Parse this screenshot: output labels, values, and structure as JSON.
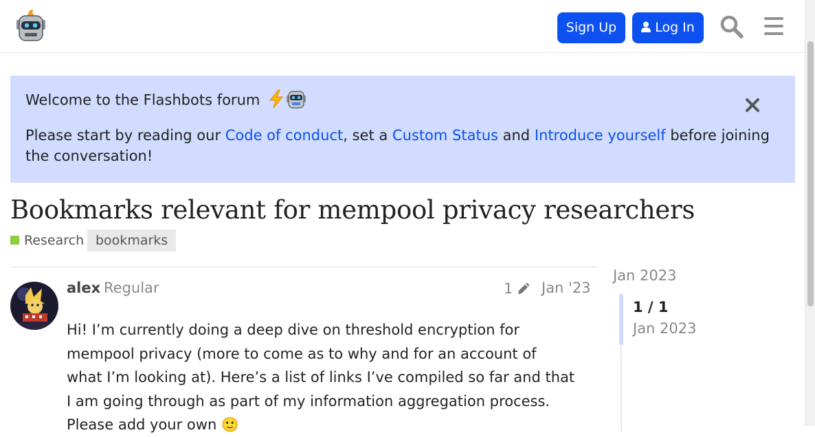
{
  "header": {
    "signup_label": "Sign Up",
    "login_label": "Log In",
    "accent_color": "#0c50f0",
    "logo_icon": "robot-logo",
    "search_icon": "search-icon",
    "menu_icon": "hamburger-menu-icon"
  },
  "banner": {
    "title": "Welcome to the Flashbots forum",
    "text_before": "Please start by reading our ",
    "link1": "Code of conduct",
    "text_mid1": ", set a ",
    "link2": "Custom Status",
    "text_mid2": " and ",
    "link3": "Introduce yourself",
    "text_after": " before joining the conversation!",
    "background": "#d1dcfe"
  },
  "topic": {
    "title": "Bookmarks relevant for mempool privacy researchers",
    "category": "Research",
    "category_color": "#92cc41",
    "tag": "bookmarks"
  },
  "post": {
    "username": "alex",
    "user_title": "Regular",
    "edit_count": "1",
    "date": "Jan '23",
    "body": "Hi! I’m currently doing a deep dive on threshold encryption for mempool privacy (more to come as to why and for an account of what I’m looking at). Here’s a list of links I’ve compiled so far and that I am going through as part of my information aggregation process. Please add your own 🙂"
  },
  "timeline": {
    "start_date": "Jan 2023",
    "count": "1 / 1",
    "current_date": "Jan 2023"
  }
}
